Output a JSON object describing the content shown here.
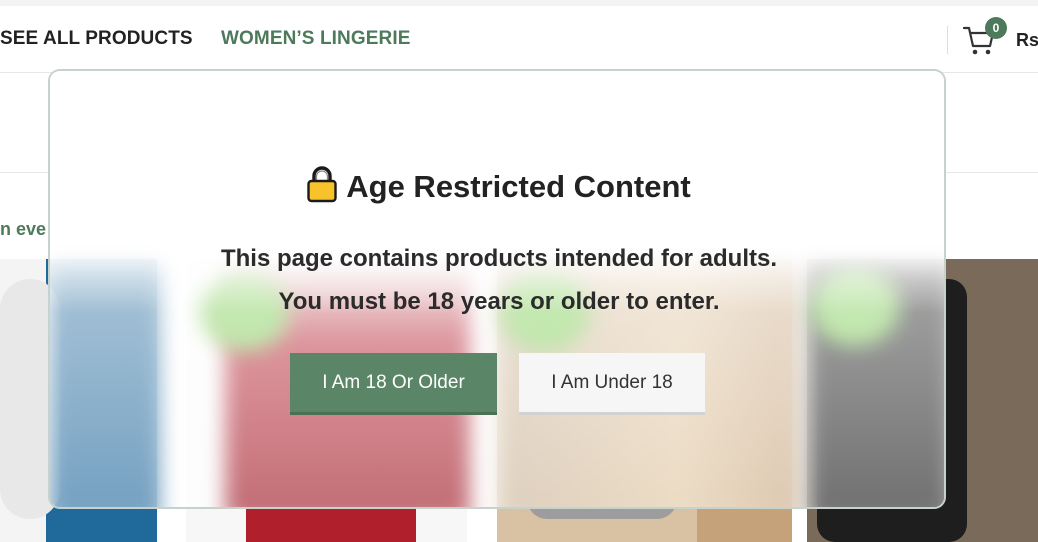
{
  "navbar": {
    "see_all_products": "SEE ALL PRODUCTS",
    "womens_lingerie": "WOMEN’S LINGERIE",
    "cart_count": "0",
    "currency": "Rs"
  },
  "promo_text": "n eve",
  "modal": {
    "icon": "lock-icon",
    "title": "Age Restricted Content",
    "line1": "This page contains products intended for adults.",
    "line2": "You must be 18 years or older to enter.",
    "confirm_label": "I Am 18 Or Older",
    "deny_label": "I Am Under 18"
  },
  "colors": {
    "brand_green": "#4e7a5c",
    "button_green": "#5a8566",
    "button_light": "#f6f6f6"
  }
}
